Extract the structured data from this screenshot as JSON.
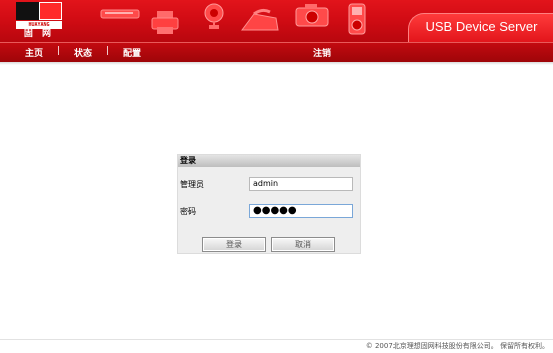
{
  "header": {
    "logo_strip": "HUAYANG TECHNOLOGY",
    "logo_cn": "固 网",
    "title": "USB Device Server",
    "icons": [
      "scanner-icon",
      "printer-icon",
      "webcam-icon",
      "iron-icon",
      "camera-icon",
      "mp3-player-icon"
    ]
  },
  "nav": {
    "items": [
      "主页",
      "状态",
      "配置"
    ],
    "separator": "|",
    "logout": "注销"
  },
  "login": {
    "title": "登录",
    "username_label": "管理员",
    "username_value": "admin",
    "password_label": "密码",
    "password_mask": "●●●●●",
    "login_button": "登录",
    "cancel_button": "取消"
  },
  "footer": {
    "copyright": "© 2007北京理想固网科技股份有限公司。 保留所有权利。"
  },
  "colors": {
    "brand_red": "#d20c14",
    "nav_red": "#b0070c",
    "panel_bg": "#eeeeee"
  }
}
